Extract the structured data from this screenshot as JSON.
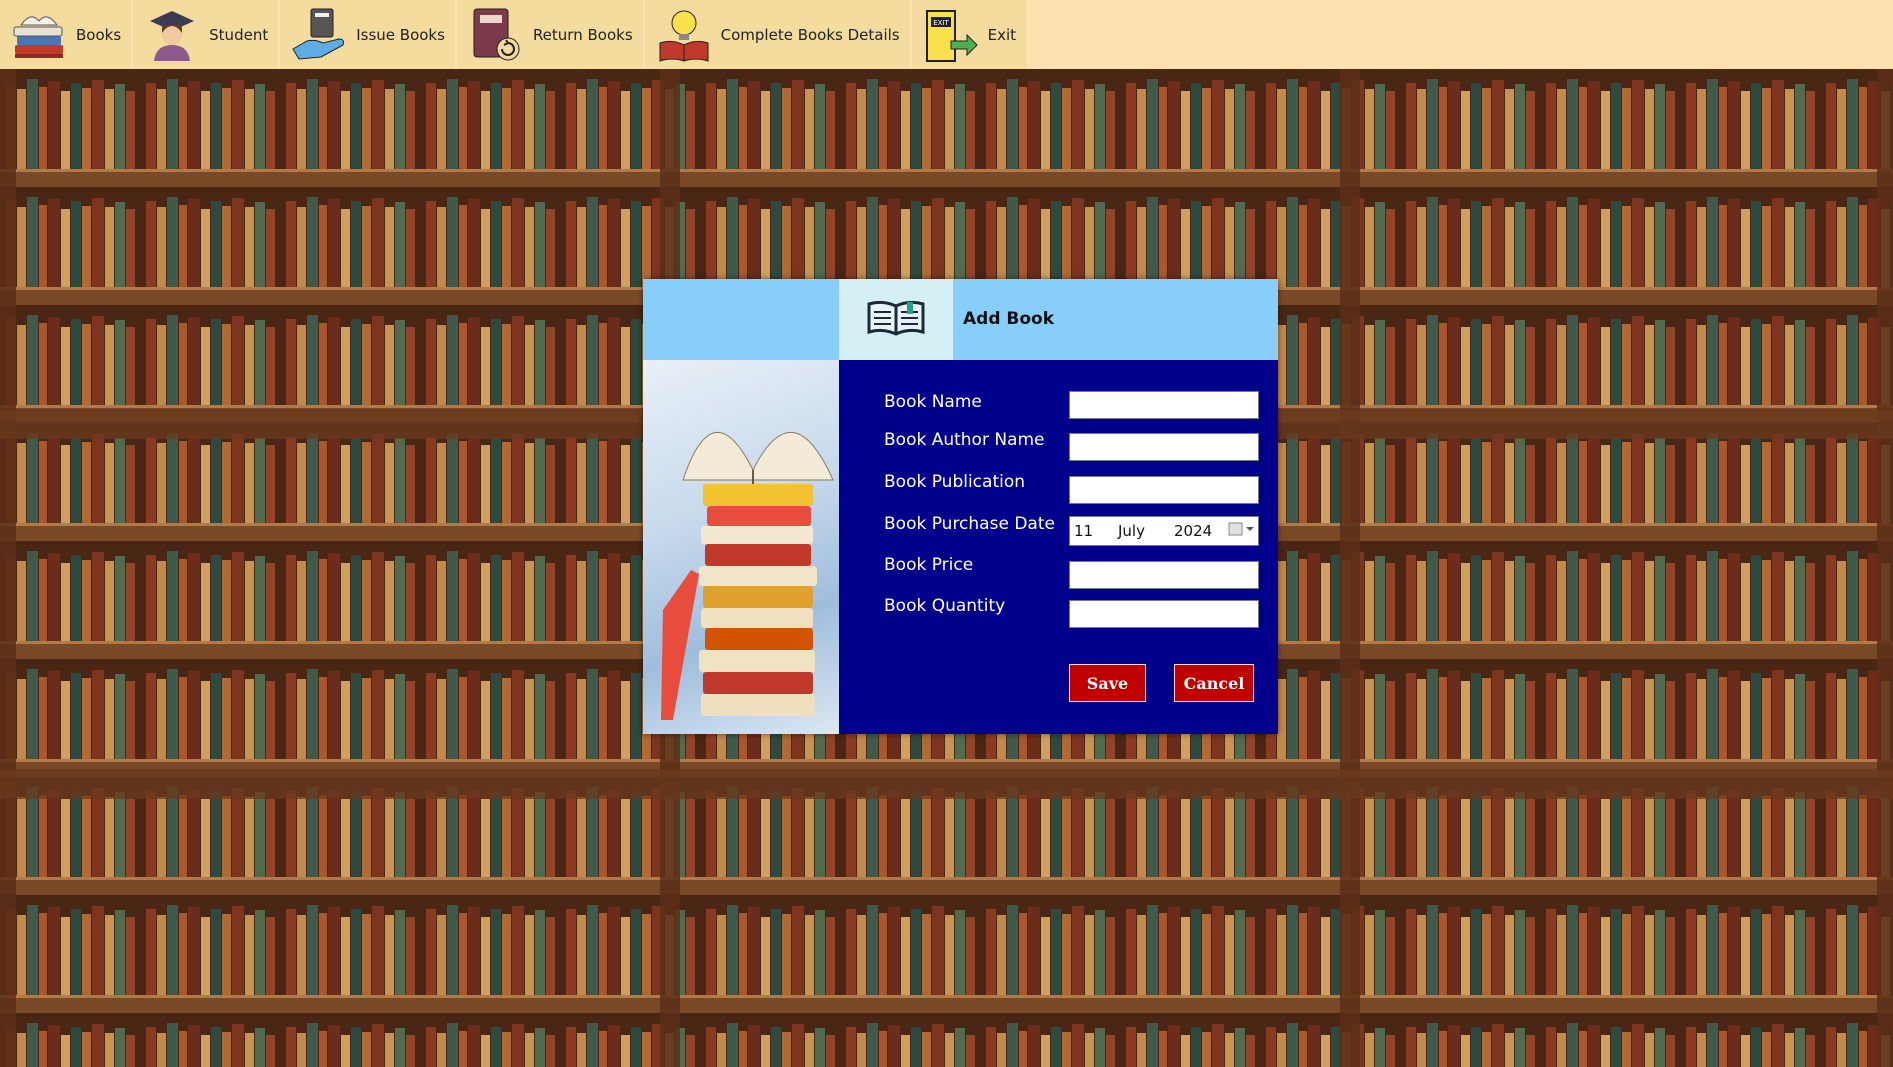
{
  "menubar": {
    "items": [
      {
        "label": "Books",
        "icon": "books-stack-icon"
      },
      {
        "label": "Student",
        "icon": "student-graduate-icon"
      },
      {
        "label": "Issue Books",
        "icon": "hand-book-icon"
      },
      {
        "label": "Return Books",
        "icon": "book-return-icon"
      },
      {
        "label": "Complete Books Details",
        "icon": "idea-book-icon"
      },
      {
        "label": "Exit",
        "icon": "exit-door-icon"
      }
    ]
  },
  "dialog": {
    "title": "Add Book",
    "header_icon": "open-book-icon",
    "fields": {
      "book_name": {
        "label": "Book Name",
        "value": ""
      },
      "author": {
        "label": "Book Author Name",
        "value": ""
      },
      "publication": {
        "label": "Book Publication",
        "value": ""
      },
      "purchase_date": {
        "label": "Book Purchase Date",
        "day": "11",
        "month": "July",
        "year": "2024"
      },
      "price": {
        "label": "Book Price",
        "value": ""
      },
      "quantity": {
        "label": "Book Quantity",
        "value": ""
      }
    },
    "save_label": "Save",
    "cancel_label": "Cancel"
  },
  "colors": {
    "menubar_bg": "#fde2b0",
    "dialog_bg": "#00008b",
    "header_bg": "#87cefa",
    "button_bg": "#c00000"
  }
}
